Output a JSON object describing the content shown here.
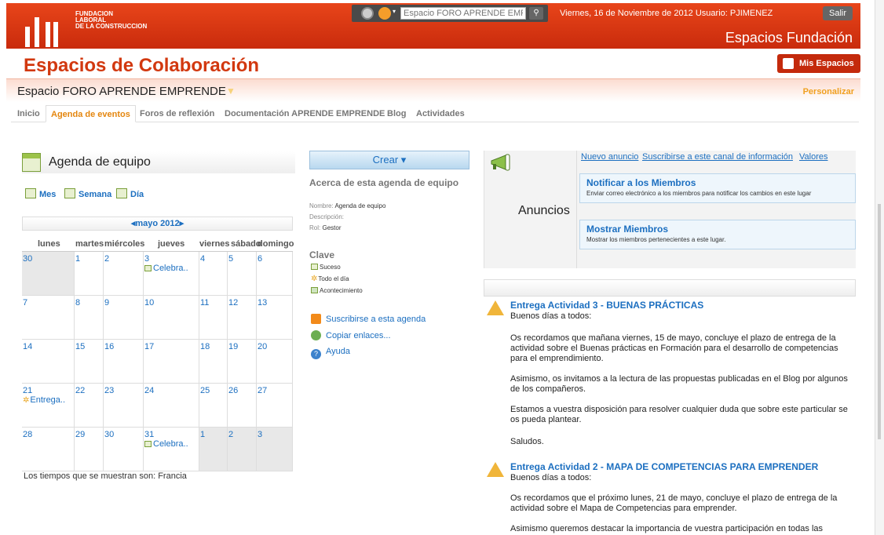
{
  "header": {
    "org_name_1": "FUNDACION",
    "org_name_2": "LABORAL",
    "org_name_3": "DE LA CONSTRUCCION",
    "search_placeholder": "Espacio FORO APRENDE EMPR",
    "date_user": "Viernes, 16 de Noviembre de 2012  Usuario: PJIMENEZ",
    "logout_label": "Salir",
    "brand_title": "Espacios Fundación",
    "brand_color": "#d2380f"
  },
  "page": {
    "title": "Espacios de Colaboración",
    "my_spaces_label": "Mis Espacios",
    "space_name": "Espacio FORO APRENDE EMPRENDE",
    "personalize_label": "Personalizar"
  },
  "tabs": [
    {
      "label": "Inicio"
    },
    {
      "label": "Agenda de eventos",
      "active": true
    },
    {
      "label": "Foros de reflexión"
    },
    {
      "label": "Documentación APRENDE EMPRENDE"
    },
    {
      "label": "Blog"
    },
    {
      "label": "Actividades"
    }
  ],
  "calendar": {
    "title": "Agenda de equipo",
    "views": {
      "month": "Mes",
      "week": "Semana",
      "day": "Día"
    },
    "month_label": "◂mayo 2012▸",
    "weekdays": [
      "lunes",
      "martes",
      "miércoles",
      "jueves",
      "viernes",
      "sábado",
      "domingo"
    ],
    "weeks": [
      [
        {
          "d": "30",
          "other": true
        },
        {
          "d": "1"
        },
        {
          "d": "2"
        },
        {
          "d": "3",
          "evt": "Celebra..",
          "kind": "suceso"
        },
        {
          "d": "4"
        },
        {
          "d": "5"
        },
        {
          "d": "6"
        }
      ],
      [
        {
          "d": "7"
        },
        {
          "d": "8"
        },
        {
          "d": "9"
        },
        {
          "d": "10"
        },
        {
          "d": "11"
        },
        {
          "d": "12"
        },
        {
          "d": "13"
        }
      ],
      [
        {
          "d": "14"
        },
        {
          "d": "15"
        },
        {
          "d": "16"
        },
        {
          "d": "17"
        },
        {
          "d": "18"
        },
        {
          "d": "19"
        },
        {
          "d": "20"
        }
      ],
      [
        {
          "d": "21",
          "evt": "Entrega..",
          "kind": "allday"
        },
        {
          "d": "22"
        },
        {
          "d": "23"
        },
        {
          "d": "24"
        },
        {
          "d": "25"
        },
        {
          "d": "26"
        },
        {
          "d": "27"
        }
      ],
      [
        {
          "d": "28"
        },
        {
          "d": "29"
        },
        {
          "d": "30"
        },
        {
          "d": "31",
          "evt": "Celebra..",
          "kind": "suceso"
        },
        {
          "d": "1",
          "other": true
        },
        {
          "d": "2",
          "other": true
        },
        {
          "d": "3",
          "other": true
        }
      ]
    ],
    "timezone_note": "Los tiempos que se muestran son: Francia"
  },
  "about": {
    "create_label": "Crear ▾",
    "title": "Acerca de esta agenda de equipo",
    "name_label": "Nombre:",
    "name_value": "Agenda de equipo",
    "description_label": "Descripción:",
    "role_label": "Rol:",
    "role_value": "Gestor",
    "key_title": "Clave",
    "key_items": [
      "Suceso",
      "Todo el día",
      "Acontecimiento"
    ],
    "actions": [
      "Suscribirse a esta agenda",
      "Copiar enlaces...",
      "Ayuda"
    ]
  },
  "announcements": {
    "title": "Anuncios",
    "links": [
      "Nuevo anuncio",
      "Suscribirse a este canal de información",
      "Valores"
    ],
    "notify_title": "Notificar a los Miembros",
    "notify_desc": "Enviar correo electrónico a los miembros para notificar los cambios en este lugar",
    "members_title": "Mostrar Miembros",
    "members_desc": "Mostrar los miembros pertenecientes a este lugar.",
    "posts": [
      {
        "title": "Entrega Actividad 3 - BUENAS PRÁCTICAS",
        "lines": [
          "Buenos días a todos:",
          "Os recordamos que mañana viernes, 15 de mayo, concluye el plazo de entrega de la actividad sobre el Buenas prácticas en Formación para el desarrollo de competencias para el emprendimiento.",
          "Asimismo, os invitamos a la lectura de las propuestas publicadas en el Blog por algunos de los compañeros.",
          "Estamos a vuestra disposición para resolver cualquier duda que sobre este particular se os pueda plantear.",
          "Saludos."
        ]
      },
      {
        "title": "Entrega Actividad 2 - MAPA DE COMPETENCIAS PARA EMPRENDER",
        "lines": [
          "Buenos días a todos:",
          "Os recordamos que el próximo lunes, 21 de mayo, concluye el plazo de entrega de la actividad sobre el Mapa de Competencias para emprender.",
          "Asimismo queremos destacar la importancia de vuestra participación en todas las"
        ]
      }
    ]
  }
}
